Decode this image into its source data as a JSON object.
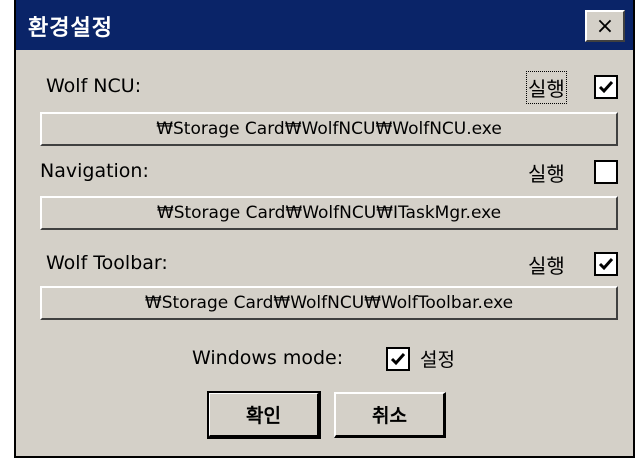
{
  "window": {
    "title": "환경설정",
    "close_label": "×"
  },
  "sections": [
    {
      "label": "Wolf NCU:",
      "run_label": "실행",
      "checked": true,
      "path": "₩Storage Card₩WolfNCU₩WolfNCU.exe"
    },
    {
      "label": "Navigation:",
      "run_label": "실행",
      "checked": false,
      "path": "₩Storage Card₩WolfNCU₩ITaskMgr.exe"
    },
    {
      "label": "Wolf Toolbar:",
      "run_label": "실행",
      "checked": true,
      "path": "₩Storage Card₩WolfNCU₩WolfToolbar.exe"
    }
  ],
  "windows_mode": {
    "label": "Windows mode:",
    "checked": true,
    "setting_label": "설정"
  },
  "buttons": {
    "ok": "확인",
    "cancel": "취소"
  }
}
